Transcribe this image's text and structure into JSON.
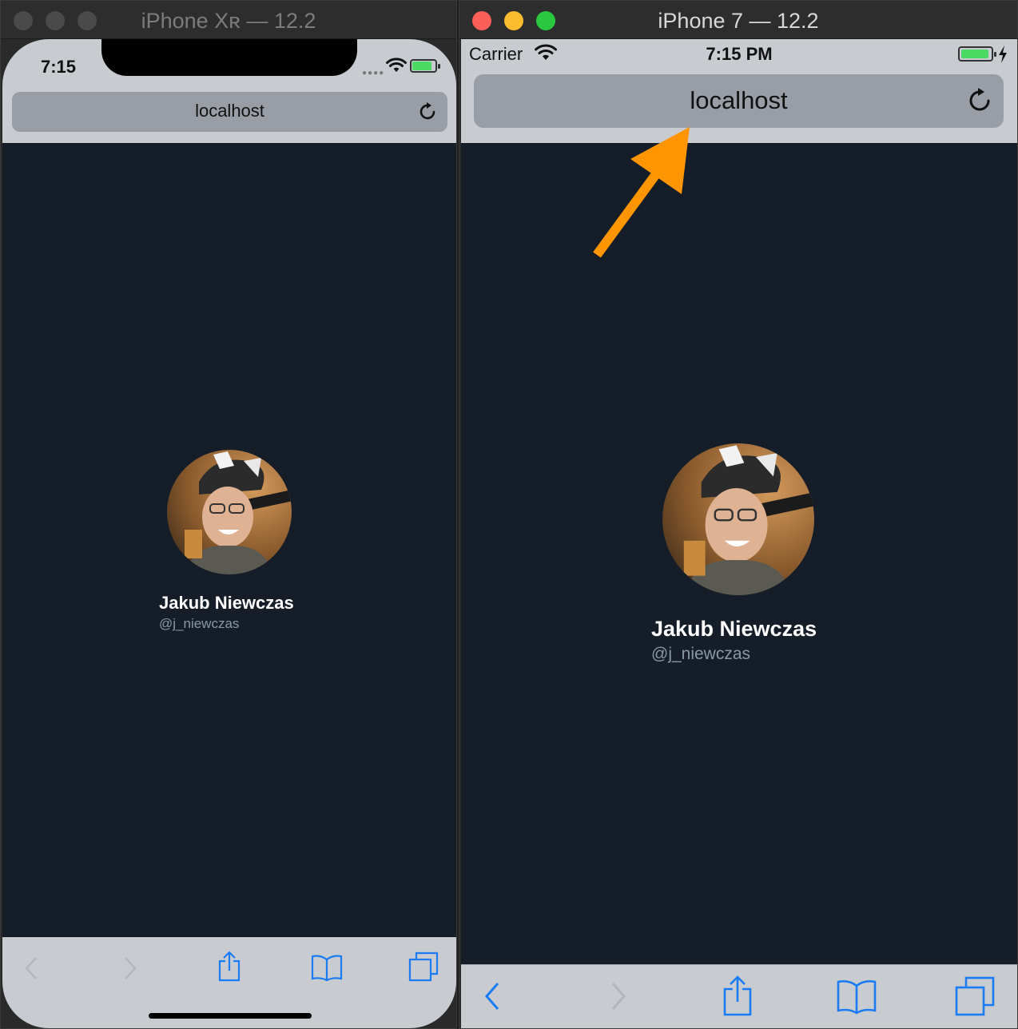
{
  "left_window": {
    "title": "iPhone Xʀ — 12.2",
    "status": {
      "time": "7:15"
    },
    "browser": {
      "url": "localhost"
    },
    "profile": {
      "name": "Jakub Niewczas",
      "handle": "@j_niewczas"
    }
  },
  "right_window": {
    "title": "iPhone 7 — 12.2",
    "status": {
      "carrier": "Carrier",
      "time": "7:15 PM"
    },
    "browser": {
      "url": "localhost"
    },
    "profile": {
      "name": "Jakub Niewczas",
      "handle": "@j_niewczas"
    }
  },
  "colors": {
    "page_bg": "#151d28",
    "safari_chrome": "#c8cbcf",
    "url_field": "#999ea6",
    "handle_text": "#8899a6",
    "ios_blue": "#1a7cf4",
    "arrow": "#ff9500"
  },
  "icons": {
    "toolbar": [
      "back-icon",
      "forward-icon",
      "share-icon",
      "bookmarks-icon",
      "tabs-icon"
    ],
    "status": [
      "wifi-icon",
      "battery-icon",
      "charging-bolt-icon"
    ]
  }
}
